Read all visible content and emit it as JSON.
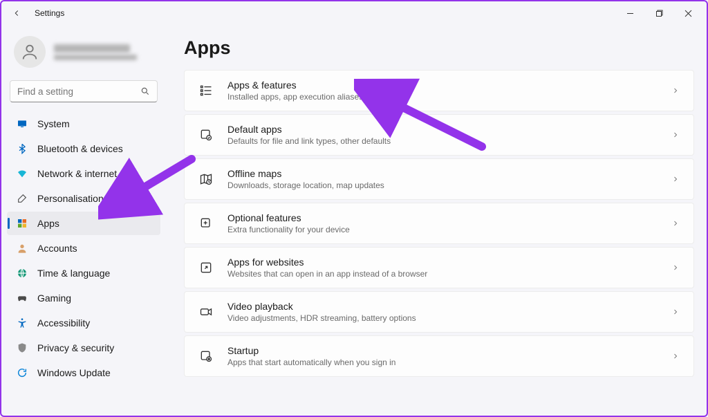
{
  "app_title": "Settings",
  "search": {
    "placeholder": "Find a setting"
  },
  "sidebar": {
    "items": [
      {
        "label": "System"
      },
      {
        "label": "Bluetooth & devices"
      },
      {
        "label": "Network & internet"
      },
      {
        "label": "Personalisation"
      },
      {
        "label": "Apps"
      },
      {
        "label": "Accounts"
      },
      {
        "label": "Time & language"
      },
      {
        "label": "Gaming"
      },
      {
        "label": "Accessibility"
      },
      {
        "label": "Privacy & security"
      },
      {
        "label": "Windows Update"
      }
    ]
  },
  "page_title": "Apps",
  "cards": [
    {
      "title": "Apps & features",
      "desc": "Installed apps, app execution aliases"
    },
    {
      "title": "Default apps",
      "desc": "Defaults for file and link types, other defaults"
    },
    {
      "title": "Offline maps",
      "desc": "Downloads, storage location, map updates"
    },
    {
      "title": "Optional features",
      "desc": "Extra functionality for your device"
    },
    {
      "title": "Apps for websites",
      "desc": "Websites that can open in an app instead of a browser"
    },
    {
      "title": "Video playback",
      "desc": "Video adjustments, HDR streaming, battery options"
    },
    {
      "title": "Startup",
      "desc": "Apps that start automatically when you sign in"
    }
  ]
}
